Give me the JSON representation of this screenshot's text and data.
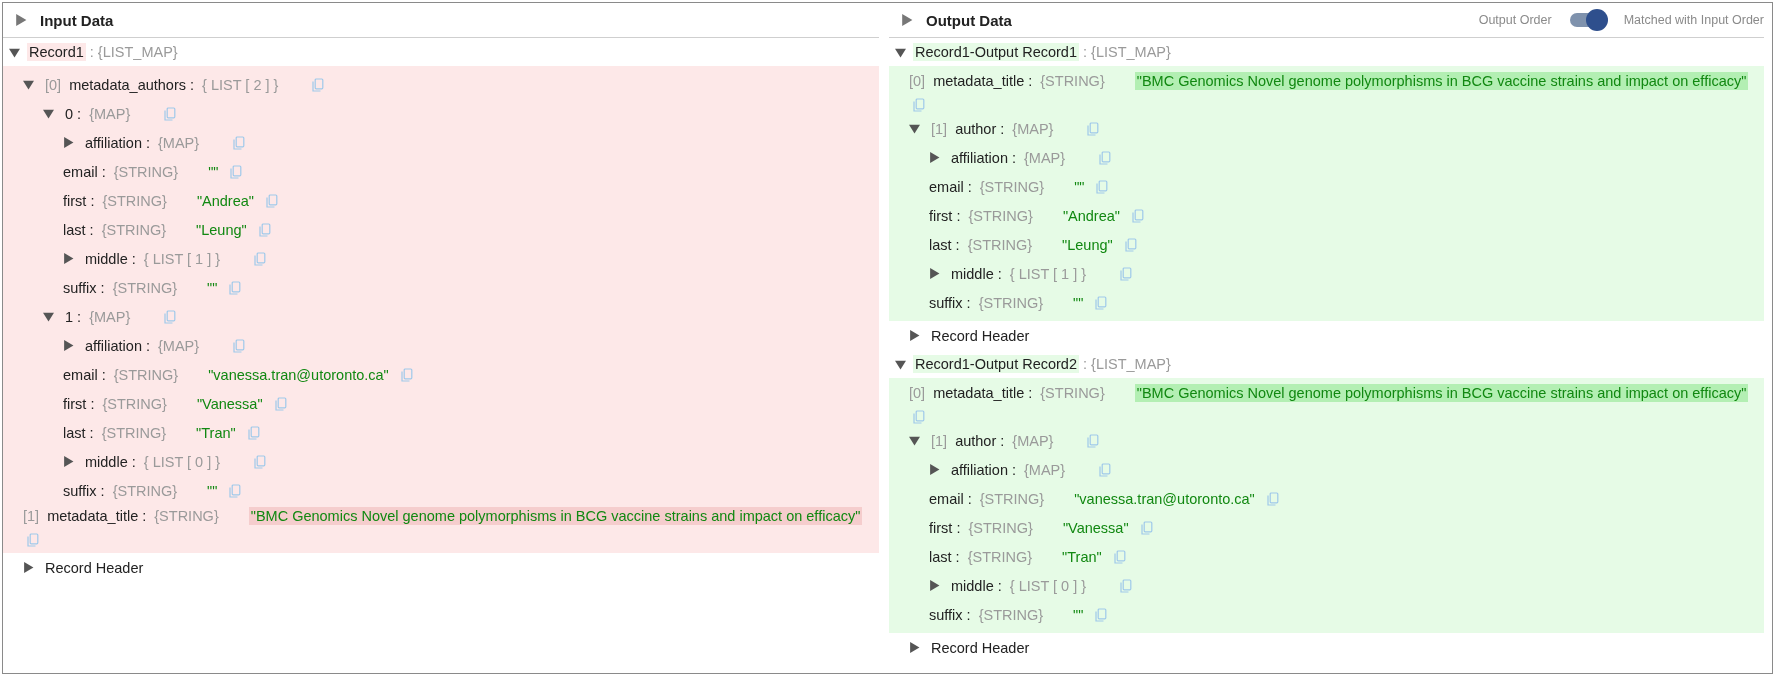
{
  "panels": [
    {
      "title": "Input Data",
      "records": [
        {
          "name": "Record1",
          "type": ": {LIST_MAP}",
          "color": "#fde8e8",
          "header": "Record Header",
          "header_expanded": false,
          "children": [
            {
              "index": "[0]",
              "key": "metadata_authors :",
              "type": "{ LIST [ 2 ] }",
              "expanded": true,
              "children": [
                {
                  "key": "0 :",
                  "type": "{MAP}",
                  "expanded": true,
                  "children": [
                    {
                      "key": "affiliation :",
                      "type": "{MAP}",
                      "expanded": false
                    },
                    {
                      "key": "email :",
                      "type": "{STRING}",
                      "value": "\"\""
                    },
                    {
                      "key": "first :",
                      "type": "{STRING}",
                      "value": "\"Andrea\""
                    },
                    {
                      "key": "last :",
                      "type": "{STRING}",
                      "value": "\"Leung\""
                    },
                    {
                      "key": "middle :",
                      "type": "{ LIST [ 1 ] }",
                      "expanded": false
                    },
                    {
                      "key": "suffix :",
                      "type": "{STRING}",
                      "value": "\"\""
                    }
                  ]
                },
                {
                  "key": "1 :",
                  "type": "{MAP}",
                  "expanded": true,
                  "children": [
                    {
                      "key": "affiliation :",
                      "type": "{MAP}",
                      "expanded": false
                    },
                    {
                      "key": "email :",
                      "type": "{STRING}",
                      "value": "\"vanessa.tran@utoronto.ca\""
                    },
                    {
                      "key": "first :",
                      "type": "{STRING}",
                      "value": "\"Vanessa\""
                    },
                    {
                      "key": "last :",
                      "type": "{STRING}",
                      "value": "\"Tran\""
                    },
                    {
                      "key": "middle :",
                      "type": "{ LIST [ 0 ] }",
                      "expanded": false
                    },
                    {
                      "key": "suffix :",
                      "type": "{STRING}",
                      "value": "\"\""
                    }
                  ]
                }
              ]
            },
            {
              "index": "[1]",
              "key": "metadata_title :",
              "type": "{STRING}",
              "value": "\"BMC Genomics Novel genome polymorphisms in BCG vaccine strains and impact on efficacy\"",
              "highlighted": true
            }
          ]
        }
      ]
    },
    {
      "title": "Output Data",
      "toggle": {
        "label": "Output Order",
        "on": true,
        "caption": "Matched with Input Order"
      },
      "records": [
        {
          "name": "Record1-Output Record1",
          "type": ": {LIST_MAP}",
          "color": "#e6fbe6",
          "header": "Record Header",
          "header_expanded": false,
          "children": [
            {
              "index": "[0]",
              "key": "metadata_title :",
              "type": "{STRING}",
              "value": "\"BMC Genomics Novel genome polymorphisms in BCG vaccine strains and impact on efficacy\"",
              "highlighted": true
            },
            {
              "index": "[1]",
              "key": "author :",
              "type": "{MAP}",
              "expanded": true,
              "children": [
                {
                  "key": "affiliation :",
                  "type": "{MAP}",
                  "expanded": false
                },
                {
                  "key": "email :",
                  "type": "{STRING}",
                  "value": "\"\""
                },
                {
                  "key": "first :",
                  "type": "{STRING}",
                  "value": "\"Andrea\""
                },
                {
                  "key": "last :",
                  "type": "{STRING}",
                  "value": "\"Leung\""
                },
                {
                  "key": "middle :",
                  "type": "{ LIST [ 1 ] }",
                  "expanded": false
                },
                {
                  "key": "suffix :",
                  "type": "{STRING}",
                  "value": "\"\""
                }
              ]
            }
          ]
        },
        {
          "name": "Record1-Output Record2",
          "type": ": {LIST_MAP}",
          "color": "#e6fbe6",
          "header": "Record Header",
          "header_expanded": false,
          "children": [
            {
              "index": "[0]",
              "key": "metadata_title :",
              "type": "{STRING}",
              "value": "\"BMC Genomics Novel genome polymorphisms in BCG vaccine strains and impact on efficacy\"",
              "highlighted": true
            },
            {
              "index": "[1]",
              "key": "author :",
              "type": "{MAP}",
              "expanded": true,
              "children": [
                {
                  "key": "affiliation :",
                  "type": "{MAP}",
                  "expanded": false
                },
                {
                  "key": "email :",
                  "type": "{STRING}",
                  "value": "\"vanessa.tran@utoronto.ca\""
                },
                {
                  "key": "first :",
                  "type": "{STRING}",
                  "value": "\"Vanessa\""
                },
                {
                  "key": "last :",
                  "type": "{STRING}",
                  "value": "\"Tran\""
                },
                {
                  "key": "middle :",
                  "type": "{ LIST [ 0 ] }",
                  "expanded": false
                },
                {
                  "key": "suffix :",
                  "type": "{STRING}",
                  "value": "\"\""
                }
              ]
            }
          ]
        }
      ]
    }
  ]
}
